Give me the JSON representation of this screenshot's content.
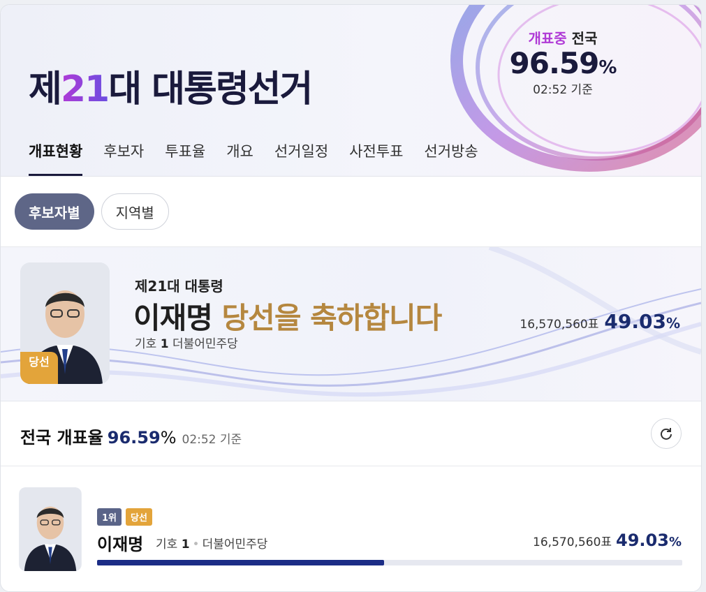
{
  "header": {
    "title_prefix": "제",
    "title_number": "21",
    "title_suffix": "대 대통령선거",
    "status_live": "개표중",
    "status_scope": "전국",
    "status_percent": "96.59",
    "status_percent_unit": "%",
    "status_time": "02:52 기준"
  },
  "tabs": [
    {
      "label": "개표현황",
      "active": true
    },
    {
      "label": "후보자"
    },
    {
      "label": "투표율"
    },
    {
      "label": "개요"
    },
    {
      "label": "선거일정"
    },
    {
      "label": "사전투표"
    },
    {
      "label": "선거방송"
    }
  ],
  "filters": {
    "by_candidate": "후보자별",
    "by_region": "지역별"
  },
  "banner": {
    "subtitle": "제21대 대통령",
    "name": "이재명",
    "headline_rest": "당선을 축하합니다",
    "number_label": "기호",
    "number": "1",
    "party": "더불어민주당",
    "win_badge": "당선",
    "votes": "16,570,560표",
    "percent": "49.03",
    "percent_unit": "%"
  },
  "rate": {
    "label": "전국 개표율",
    "value": "96.59",
    "unit": "%",
    "time": "02:52 기준"
  },
  "candidate": {
    "rank": "1위",
    "win": "당선",
    "name": "이재명",
    "number_label": "기호",
    "number": "1",
    "party": "더불어민주당",
    "votes": "16,570,560표",
    "percent": "49.03",
    "percent_unit": "%",
    "share": 0.4903
  },
  "colors": {
    "accent": "#1a2b6e",
    "win_gold": "#e3a43a",
    "chip_active": "#5e6687"
  }
}
